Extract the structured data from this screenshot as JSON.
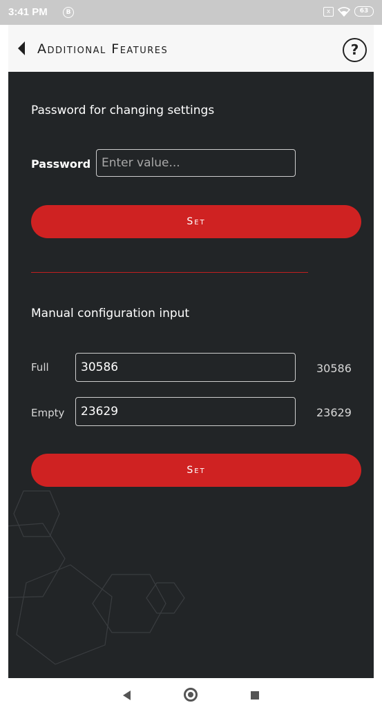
{
  "status_bar": {
    "time": "3:41 PM",
    "badge": "B",
    "sim_icon": "x",
    "battery": "63"
  },
  "header": {
    "title": "Additional Features",
    "help": "?"
  },
  "password_section": {
    "title": "Password for changing settings",
    "field_label": "Password",
    "placeholder": "Enter value...",
    "button": "Set"
  },
  "manual_section": {
    "title": "Manual configuration input",
    "rows": [
      {
        "label": "Full",
        "value": "30586",
        "readout": "30586"
      },
      {
        "label": "Empty",
        "value": "23629",
        "readout": "23629"
      }
    ],
    "button": "Set"
  },
  "colors": {
    "accent": "#cf2222",
    "background": "#222527"
  }
}
